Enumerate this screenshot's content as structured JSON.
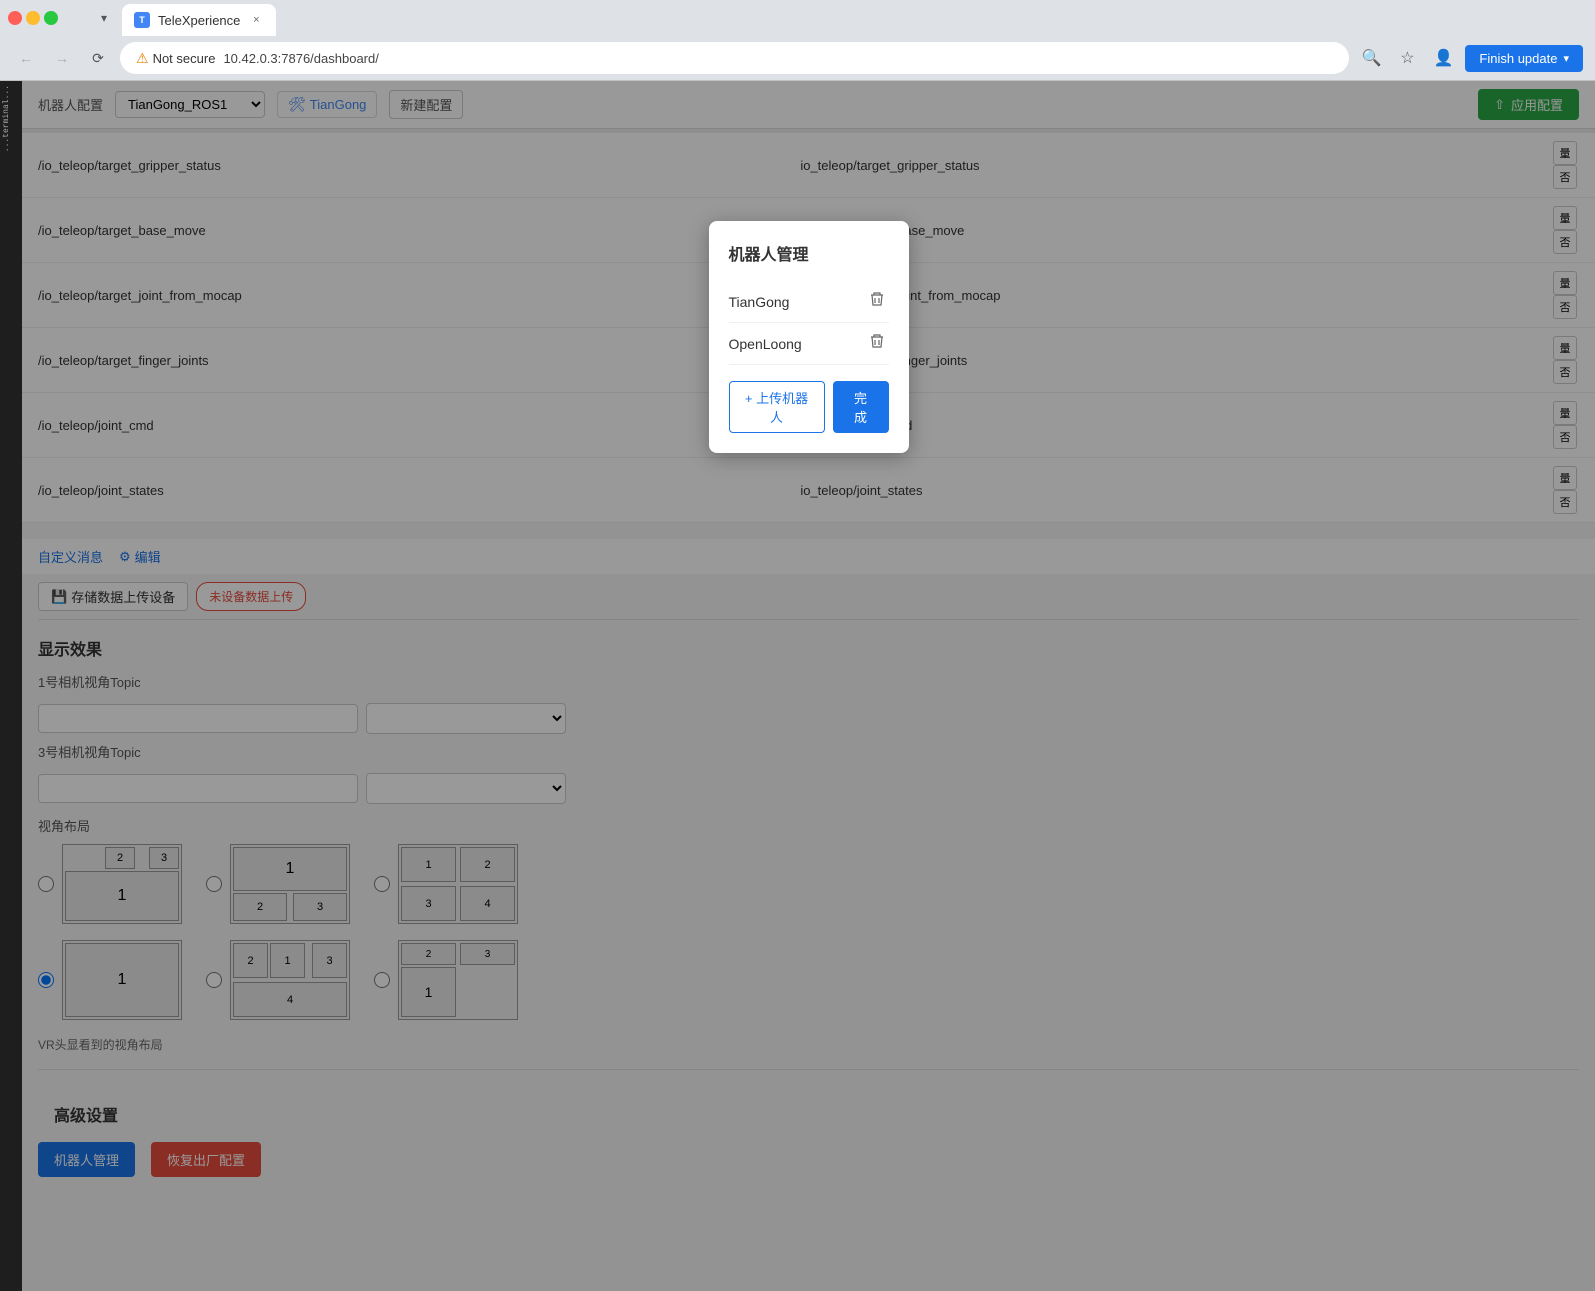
{
  "browser": {
    "tab_title": "TeleXperience",
    "close_btn": "×",
    "address": "10.42.0.3:7876/dashboard/",
    "not_secure_label": "Not secure",
    "finish_update_label": "Finish update"
  },
  "config_bar": {
    "label": "机器人配置",
    "selected": "TianGong_ROS1",
    "active_tag": "TianGong",
    "new_config_label": "新建配置",
    "apply_label": "应用配置"
  },
  "topic_rows": [
    {
      "left": "/io_teleop/target_gripper_status",
      "right": "io_teleop/target_gripper_status"
    },
    {
      "left": "/io_teleop/target_base_move",
      "right": "io_teleop/target_base_move"
    },
    {
      "left": "/io_teleop/target_joint_from_mocap",
      "right": "io_teleop/target_joint_from_mocap"
    },
    {
      "left": "/io_teleop/target_finger_joints",
      "right": "io_teleop/target_finger_joints"
    },
    {
      "left": "/io_teleop/joint_cmd",
      "right": "io_teleop/joint_cmd"
    },
    {
      "left": "/io_teleop/joint_states",
      "right": "io_teleop/joint_states"
    }
  ],
  "toolbar": {
    "custom_msg_label": "自定义消息",
    "edit_label": "编辑",
    "save_upload_label": "存储数据上传设备",
    "not_uploaded_label": "未设备数据上传"
  },
  "display_section": {
    "title": "显示效果",
    "cam1_label": "1号相机视角Topic",
    "cam3_label": "3号相机视角Topic",
    "layout_label": "视角布局",
    "vr_label": "VR头显看到的视角布局"
  },
  "advanced_section": {
    "title": "高级设置",
    "robot_mgmt_label": "机器人管理",
    "factory_reset_label": "恢复出厂配置"
  },
  "modal": {
    "title": "机器人管理",
    "robots": [
      {
        "name": "TianGong"
      },
      {
        "name": "OpenLoong"
      }
    ],
    "upload_label": "+ 上传机器人",
    "done_label": "完成"
  }
}
